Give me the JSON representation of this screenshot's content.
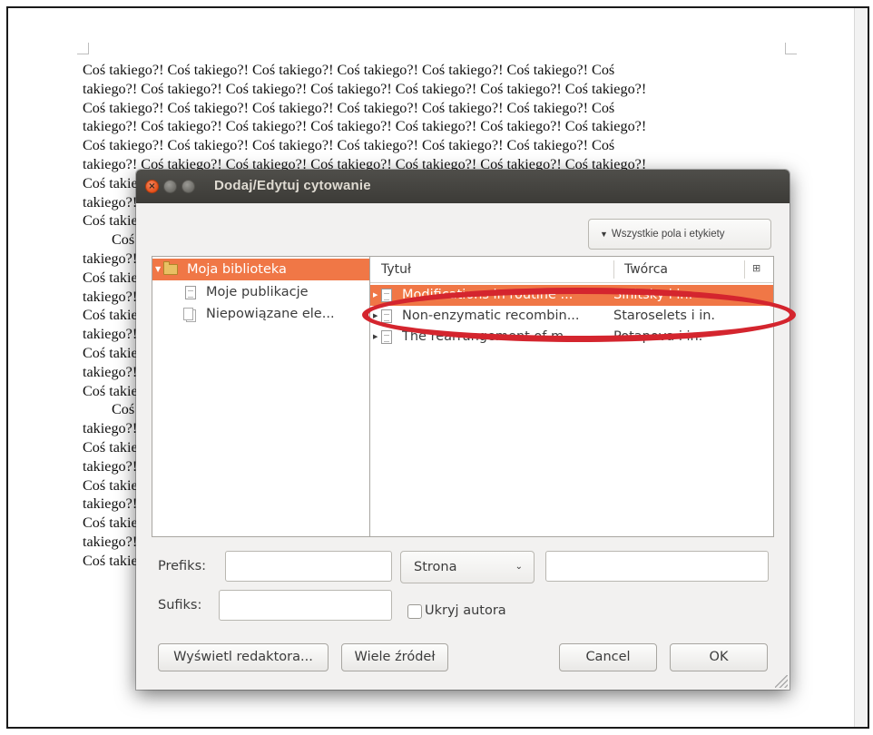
{
  "document": {
    "lines": [
      "Coś takiego?! Coś takiego?! Coś takiego?! Coś takiego?! Coś takiego?! Coś takiego?! Coś",
      "takiego?! Coś takiego?! Coś takiego?! Coś takiego?! Coś takiego?! Coś takiego?! Coś takiego?!",
      "Coś takiego?! Coś takiego?! Coś takiego?! Coś takiego?! Coś takiego?! Coś takiego?! Coś",
      "takiego?! Coś takiego?! Coś takiego?! Coś takiego?! Coś takiego?! Coś takiego?! Coś takiego?!",
      "Coś takiego?! Coś takiego?! Coś takiego?! Coś takiego?! Coś takiego?! Coś takiego?! Coś",
      "takiego?! Coś takiego?! Coś takiego?! Coś takiego?! Coś takiego?! Coś takiego?! Coś takiego?!",
      "Coś takiego?!",
      "takiego?!",
      "Coś takiego?!",
      "Coś",
      "takiego?!",
      "Coś takiego?!",
      "takiego?!",
      "Coś takiego?!",
      "takiego?!",
      "Coś takiego?!",
      "takiego?!",
      "Coś takiego?!",
      "Coś",
      "takiego?!",
      "Coś takiego?!",
      "takiego?!",
      "Coś takiego?!",
      "takiego?!",
      "Coś takiego?!",
      "takiego?!",
      "Coś takiego?!"
    ]
  },
  "dialog": {
    "title": "Dodaj/Edytuj cytowanie",
    "mode_button": "Wszystkie pola i etykiety",
    "library": [
      {
        "label": "Moja biblioteka"
      },
      {
        "label": "Moje publikacje"
      },
      {
        "label": "Niepowiązane ele..."
      }
    ],
    "columns": {
      "title": "Tytuł",
      "creator": "Twórca"
    },
    "items": [
      {
        "title": "Modifications in routine ...",
        "creator": "Sinitsky i in."
      },
      {
        "title": "Non-enzymatic recombin...",
        "creator": "Staroselets i in."
      },
      {
        "title": "The rearrangement of m...",
        "creator": "Potapova i in."
      }
    ],
    "prefix_label": "Prefiks:",
    "suffix_label": "Sufiks:",
    "locator_selected": "Strona",
    "suppress_author_label": "Ukryj autora",
    "buttons": {
      "show_editor": "Wyświetl redaktora...",
      "multiple_sources": "Wiele źródeł",
      "cancel": "Cancel",
      "ok": "OK"
    }
  }
}
